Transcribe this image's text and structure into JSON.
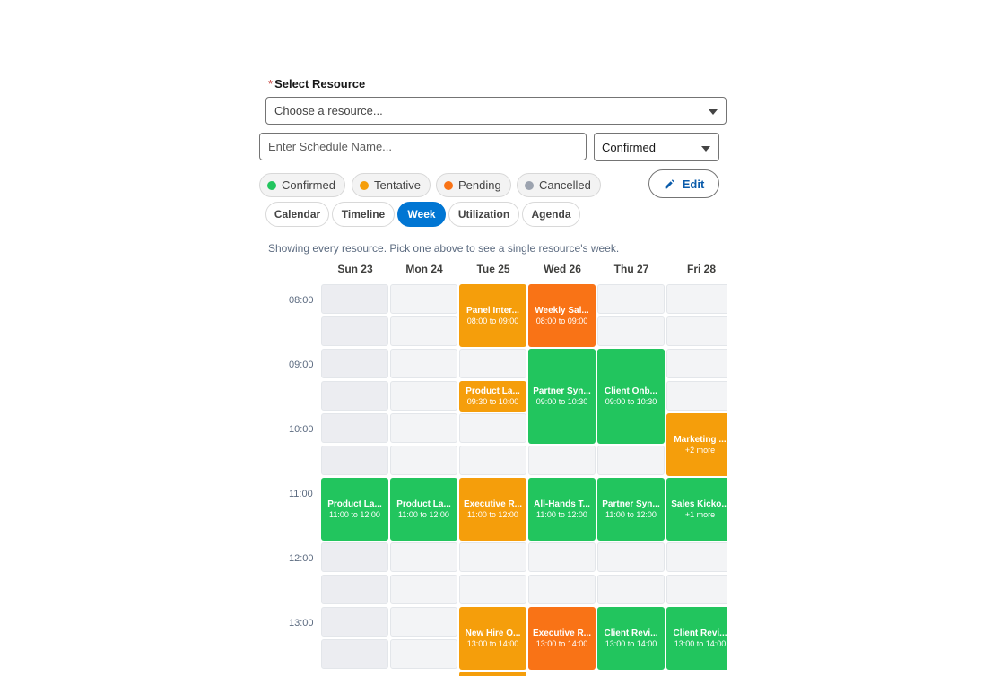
{
  "resource": {
    "label": "Select Resource",
    "required_mark": "*",
    "placeholder": "Choose a resource..."
  },
  "schedule_name": {
    "placeholder": "Enter Schedule Name..."
  },
  "status_select": {
    "value": "Confirmed"
  },
  "legend": [
    {
      "label": "Confirmed",
      "color": "#22c55e"
    },
    {
      "label": "Tentative",
      "color": "#f59e0b"
    },
    {
      "label": "Pending",
      "color": "#f97316"
    },
    {
      "label": "Cancelled",
      "color": "#9ca3af"
    }
  ],
  "edit_button": {
    "label": "Edit",
    "icon": "pencil-icon"
  },
  "views": [
    {
      "label": "Calendar",
      "active": false
    },
    {
      "label": "Timeline",
      "active": false
    },
    {
      "label": "Week",
      "active": true
    },
    {
      "label": "Utilization",
      "active": false
    },
    {
      "label": "Agenda",
      "active": false
    }
  ],
  "hint": "Showing every resource. Pick one above to see a single resource's week.",
  "days": [
    "Sun 23",
    "Mon 24",
    "Tue 25",
    "Wed 26",
    "Thu 27",
    "Fri 28"
  ],
  "times": [
    "08:00",
    "09:00",
    "10:00",
    "11:00",
    "12:00",
    "13:00"
  ],
  "events": [
    {
      "day": 2,
      "start": "08:00",
      "end": "09:00",
      "title": "Panel Inter...",
      "subtitle": "08:00 to 09:00",
      "status": "tentative"
    },
    {
      "day": 3,
      "start": "08:00",
      "end": "09:00",
      "title": "Weekly Sal...",
      "subtitle": "08:00 to 09:00",
      "status": "pending"
    },
    {
      "day": 2,
      "start": "09:30",
      "end": "10:00",
      "title": "Product La...",
      "subtitle": "09:30 to 10:00",
      "status": "tentative"
    },
    {
      "day": 3,
      "start": "09:00",
      "end": "10:30",
      "title": "Partner Syn...",
      "subtitle": "09:00 to 10:30",
      "status": "confirmed"
    },
    {
      "day": 4,
      "start": "09:00",
      "end": "10:30",
      "title": "Client Onb...",
      "subtitle": "09:00 to 10:30",
      "status": "confirmed"
    },
    {
      "day": 5,
      "start": "10:00",
      "end": "11:00",
      "title": "Marketing ...",
      "subtitle": "+2 more",
      "status": "tentative"
    },
    {
      "day": 0,
      "start": "11:00",
      "end": "12:00",
      "title": "Product La...",
      "subtitle": "11:00 to 12:00",
      "status": "confirmed"
    },
    {
      "day": 1,
      "start": "11:00",
      "end": "12:00",
      "title": "Product La...",
      "subtitle": "11:00 to 12:00",
      "status": "confirmed"
    },
    {
      "day": 2,
      "start": "11:00",
      "end": "12:00",
      "title": "Executive R...",
      "subtitle": "11:00 to 12:00",
      "status": "tentative"
    },
    {
      "day": 3,
      "start": "11:00",
      "end": "12:00",
      "title": "All-Hands T...",
      "subtitle": "11:00 to 12:00",
      "status": "confirmed"
    },
    {
      "day": 4,
      "start": "11:00",
      "end": "12:00",
      "title": "Partner Syn...",
      "subtitle": "11:00 to 12:00",
      "status": "confirmed"
    },
    {
      "day": 5,
      "start": "11:00",
      "end": "12:00",
      "title": "Sales Kicko...",
      "subtitle": "+1 more",
      "status": "confirmed"
    },
    {
      "day": 2,
      "start": "13:00",
      "end": "14:00",
      "title": "New Hire O...",
      "subtitle": "13:00 to 14:00",
      "status": "tentative"
    },
    {
      "day": 3,
      "start": "13:00",
      "end": "14:00",
      "title": "Executive R...",
      "subtitle": "13:00 to 14:00",
      "status": "pending"
    },
    {
      "day": 4,
      "start": "13:00",
      "end": "14:00",
      "title": "Client Revi...",
      "subtitle": "13:00 to 14:00",
      "status": "confirmed"
    },
    {
      "day": 5,
      "start": "13:00",
      "end": "14:00",
      "title": "Client Revi...",
      "subtitle": "13:00 to 14:00",
      "status": "confirmed"
    },
    {
      "day": 2,
      "start": "14:00",
      "end": "14:30",
      "title": "",
      "subtitle": "",
      "status": "tentative"
    }
  ]
}
